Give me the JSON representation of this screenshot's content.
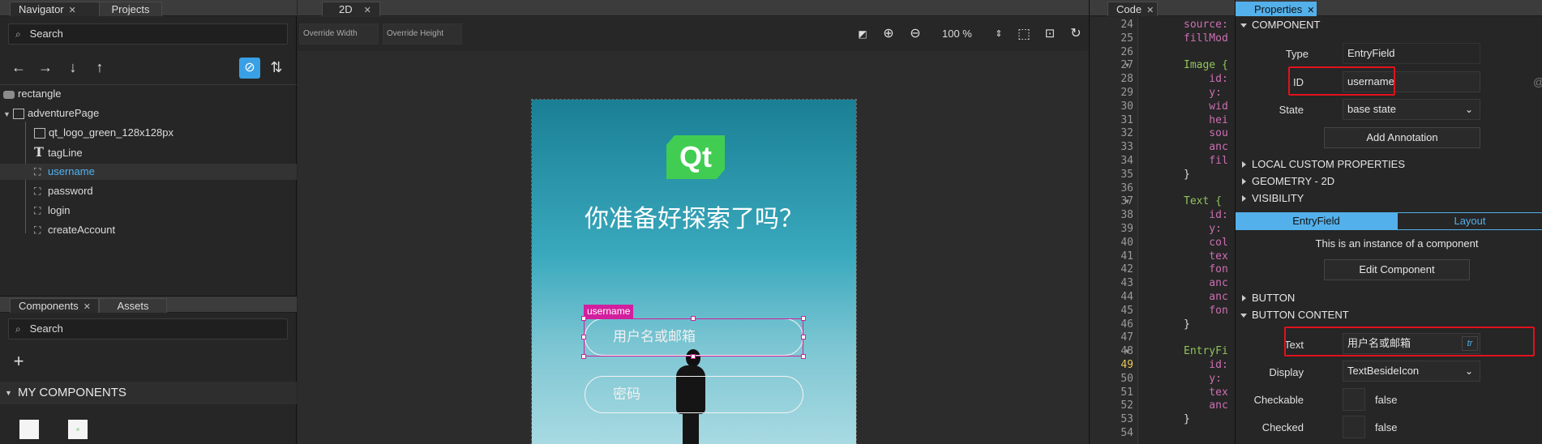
{
  "navigator": {
    "tab_navigator": "Navigator",
    "tab_projects": "Projects",
    "search_placeholder": "Search",
    "tree": [
      {
        "label": "rectangle"
      },
      {
        "label": "adventurePage"
      },
      {
        "label": "qt_logo_green_128x128px"
      },
      {
        "label": "tagLine"
      },
      {
        "label": "username",
        "selected": true
      },
      {
        "label": "password"
      },
      {
        "label": "login"
      },
      {
        "label": "createAccount"
      }
    ]
  },
  "components": {
    "tab_components": "Components",
    "tab_assets": "Assets",
    "search_placeholder": "Search",
    "section": "MY COMPONENTS"
  },
  "editor2d": {
    "tab": "2D",
    "override_width": "Override Width",
    "override_height": "Override Height",
    "zoom": "100 %"
  },
  "canvas": {
    "logo_text": "Qt",
    "tagline": "你准备好探索了吗？",
    "selection_tag": "username",
    "username_placeholder": "用户名或邮箱",
    "password_placeholder": "密码",
    "colors": {
      "accent": "#41cd52",
      "selection": "#d21f9e"
    }
  },
  "code": {
    "tab": "Code",
    "lines": [
      {
        "n": "24",
        "t": "source:",
        "c": "#cc6fb2"
      },
      {
        "n": "25",
        "t": "fillMod",
        "c": "#cc6fb2"
      },
      {
        "n": "26",
        "t": "",
        "c": "#ddd"
      },
      {
        "n": "27",
        "t": "Image {",
        "c": "#8fc45a"
      },
      {
        "n": "28",
        "t": "    id:",
        "c": "#cc6fb2"
      },
      {
        "n": "29",
        "t": "    y:",
        "c": "#cc6fb2"
      },
      {
        "n": "30",
        "t": "    wid",
        "c": "#cc6fb2"
      },
      {
        "n": "31",
        "t": "    hei",
        "c": "#cc6fb2"
      },
      {
        "n": "32",
        "t": "    sou",
        "c": "#cc6fb2"
      },
      {
        "n": "33",
        "t": "    anc",
        "c": "#cc6fb2"
      },
      {
        "n": "34",
        "t": "    fil",
        "c": "#cc6fb2"
      },
      {
        "n": "35",
        "t": "}",
        "c": "#ddd"
      },
      {
        "n": "36",
        "t": "",
        "c": "#ddd"
      },
      {
        "n": "37",
        "t": "Text {",
        "c": "#8fc45a"
      },
      {
        "n": "38",
        "t": "    id:",
        "c": "#cc6fb2"
      },
      {
        "n": "39",
        "t": "    y:",
        "c": "#cc6fb2"
      },
      {
        "n": "40",
        "t": "    col",
        "c": "#cc6fb2"
      },
      {
        "n": "41",
        "t": "    tex",
        "c": "#cc6fb2"
      },
      {
        "n": "42",
        "t": "    fon",
        "c": "#cc6fb2"
      },
      {
        "n": "43",
        "t": "    anc",
        "c": "#cc6fb2"
      },
      {
        "n": "44",
        "t": "    anc",
        "c": "#cc6fb2"
      },
      {
        "n": "45",
        "t": "    fon",
        "c": "#cc6fb2"
      },
      {
        "n": "46",
        "t": "}",
        "c": "#ddd"
      },
      {
        "n": "47",
        "t": "",
        "c": "#ddd"
      },
      {
        "n": "48",
        "t": "EntryFi",
        "c": "#8fc45a"
      },
      {
        "n": "49",
        "t": "    id:",
        "c": "#cc6fb2"
      },
      {
        "n": "50",
        "t": "    y:",
        "c": "#cc6fb2"
      },
      {
        "n": "51",
        "t": "    tex",
        "c": "#cc6fb2"
      },
      {
        "n": "52",
        "t": "    anc",
        "c": "#cc6fb2"
      },
      {
        "n": "53",
        "t": "}",
        "c": "#ddd"
      },
      {
        "n": "54",
        "t": "",
        "c": "#ddd"
      }
    ],
    "current_line": "49"
  },
  "properties": {
    "tab": "Properties",
    "section_component": "COMPONENT",
    "type_label": "Type",
    "type_value": "EntryField",
    "id_label": "ID",
    "id_value": "username",
    "at_symbol": "@",
    "state_label": "State",
    "state_value": "base state",
    "add_annotation": "Add Annotation",
    "section_local": "LOCAL CUSTOM PROPERTIES",
    "section_geometry": "GEOMETRY - 2D",
    "section_visibility": "VISIBILITY",
    "subtab_entry": "EntryField",
    "subtab_layout": "Layout",
    "instance_text": "This is an instance of a component",
    "edit_component": "Edit Component",
    "section_button": "BUTTON",
    "section_button_content": "BUTTON CONTENT",
    "text_label": "Text",
    "text_value": "用户名或邮箱",
    "tr_label": "tr",
    "display_label": "Display",
    "display_value": "TextBesideIcon",
    "checkable_label": "Checkable",
    "checkable_value": "false",
    "checked_label": "Checked",
    "checked_value": "false"
  }
}
